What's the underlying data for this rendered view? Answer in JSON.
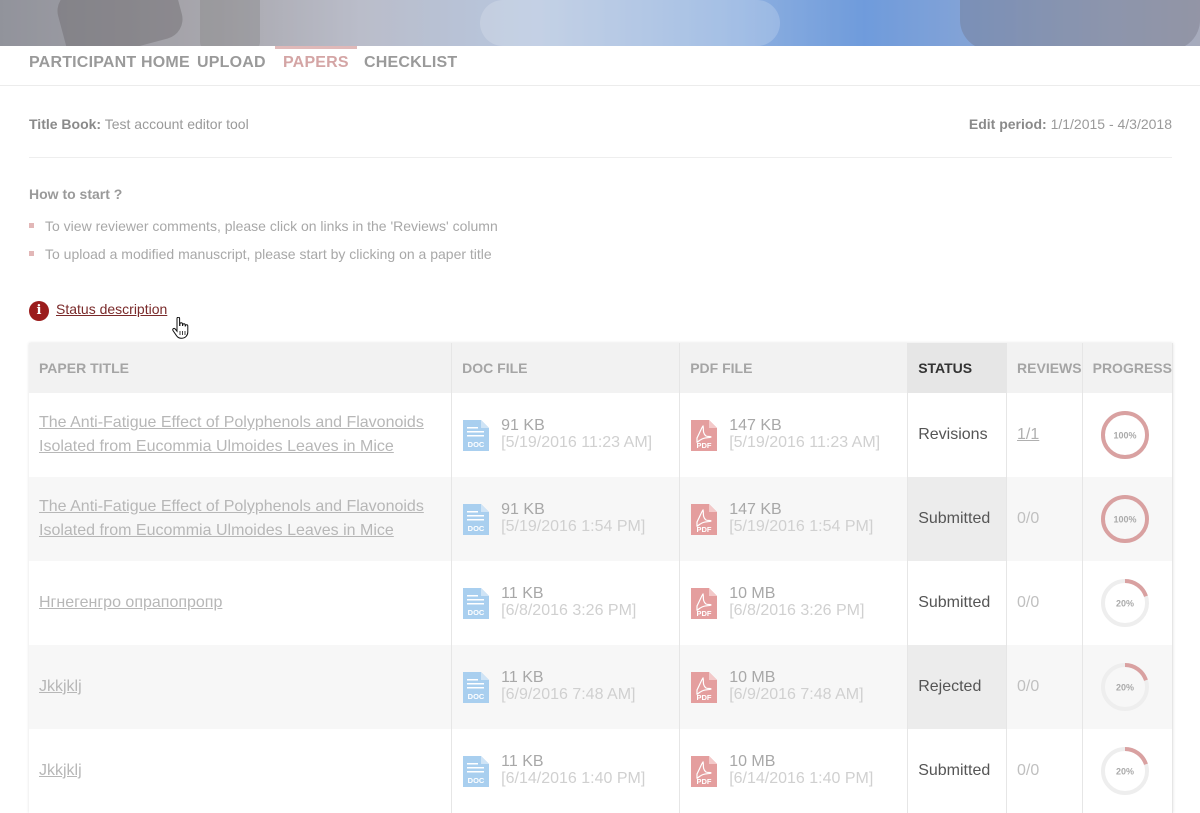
{
  "nav": {
    "items": [
      {
        "label": "PARTICIPANT HOME"
      },
      {
        "label": "UPLOAD"
      },
      {
        "label": "PAPERS",
        "active": true
      },
      {
        "label": "CHECKLIST"
      }
    ]
  },
  "info": {
    "title_label": "Title Book:",
    "title_value": "Test account editor tool",
    "edit_label": "Edit period:",
    "edit_value": "1/1/2015 - 4/3/2018"
  },
  "howto": {
    "title": "How to start ?",
    "bullets": [
      "To view reviewer comments, please click on links in the 'Reviews' column",
      "To upload a modified manuscript, please start by clicking on a paper title"
    ]
  },
  "status_description": {
    "icon": "info-icon",
    "icon_glyph": "i",
    "label": "Status description"
  },
  "table": {
    "headers": [
      "PAPER TITLE",
      "DOC FILE",
      "PDF FILE",
      "STATUS",
      "REVIEWS",
      "PROGRESS"
    ],
    "rows": [
      {
        "title": "The Anti-Fatigue Effect of Polyphenols and Flavonoids Isolated from Eucommia Ulmoides Leaves in Mice",
        "doc_size": "91 KB",
        "doc_date": "[5/19/2016 11:23 AM]",
        "pdf_size": "147 KB",
        "pdf_date": "[5/19/2016 11:23 AM]",
        "status": "Revisions",
        "reviews": "1/1",
        "reviews_link": true,
        "progress": 100,
        "progress_label": "100%"
      },
      {
        "title": "The Anti-Fatigue Effect of Polyphenols and Flavonoids Isolated from Eucommia Ulmoides Leaves in Mice",
        "doc_size": "91 KB",
        "doc_date": "[5/19/2016 1:54 PM]",
        "pdf_size": "147 KB",
        "pdf_date": "[5/19/2016 1:54 PM]",
        "status": "Submitted",
        "reviews": "0/0",
        "reviews_link": false,
        "progress": 100,
        "progress_label": "100%"
      },
      {
        "title": "Нгнегенгро опрапопропр",
        "doc_size": "11 KB",
        "doc_date": "[6/8/2016 3:26 PM]",
        "pdf_size": "10 MB",
        "pdf_date": "[6/8/2016 3:26 PM]",
        "status": "Submitted",
        "reviews": "0/0",
        "reviews_link": false,
        "progress": 20,
        "progress_label": "20%"
      },
      {
        "title": "Jkkjklj",
        "doc_size": "11 KB",
        "doc_date": "[6/9/2016 7:48 AM]",
        "pdf_size": "10 MB",
        "pdf_date": "[6/9/2016 7:48 AM]",
        "status": "Rejected",
        "reviews": "0/0",
        "reviews_link": false,
        "progress": 20,
        "progress_label": "20%"
      },
      {
        "title": "Jkkjklj",
        "doc_size": "11 KB",
        "doc_date": "[6/14/2016 1:40 PM]",
        "pdf_size": "10 MB",
        "pdf_date": "[6/14/2016 1:40 PM]",
        "status": "Submitted",
        "reviews": "0/0",
        "reviews_link": false,
        "progress": 20,
        "progress_label": "20%"
      }
    ],
    "file_icons": {
      "doc": "doc-file-icon",
      "pdf": "pdf-file-icon"
    },
    "doc_icon_text": "DOC",
    "pdf_icon_text": "PDF"
  },
  "colors": {
    "accent": "#d4a5a5",
    "status_icon": "#9b1c1c",
    "doc_icon": "#a9cfef",
    "pdf_icon": "#e49e9e",
    "progress_fill": "#d9a1a1",
    "progress_track": "#eeeeee"
  }
}
